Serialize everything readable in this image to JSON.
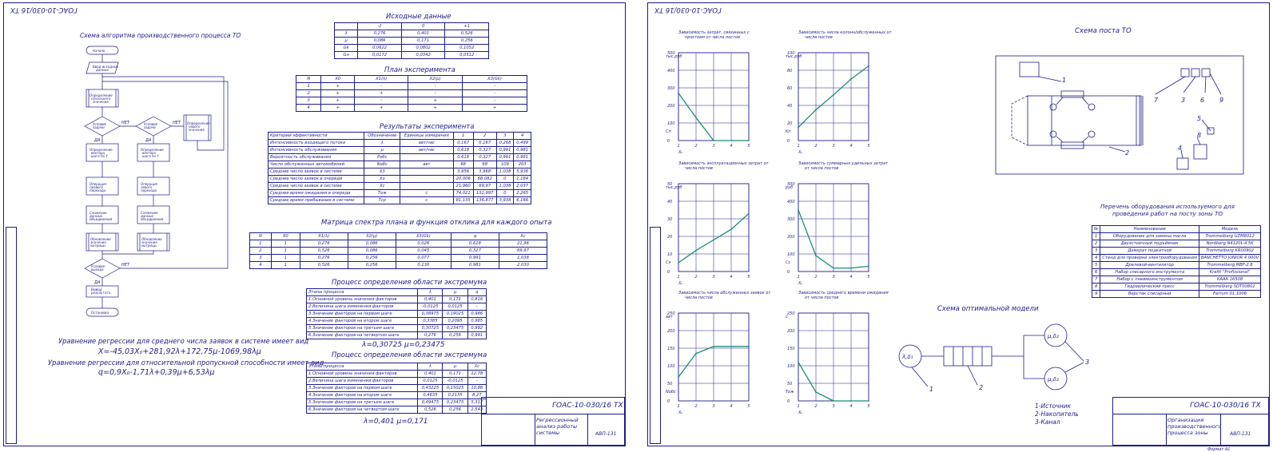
{
  "sheet1": {
    "code_rotated": "ГОАС-10-030/16 ТХ",
    "flowchart_title": "Схема алгоритма производственного процесса ТО",
    "flow": {
      "start": "Начало",
      "end": "Остановка",
      "yes": "ДА",
      "no": "НЕТ"
    },
    "initial_title": "Исходные данные",
    "initial_header": [
      "",
      "-1",
      "0",
      "+1"
    ],
    "initial_rows": [
      [
        "λ",
        "0,276",
        "0,401",
        "0,526"
      ],
      [
        "μ",
        "0,086",
        "0,171",
        "0,256"
      ],
      [
        "Gk",
        "0,0622",
        "0,0802",
        "0,1052"
      ],
      [
        "Gн",
        "0,0172",
        "0,0342",
        "0,0512"
      ]
    ],
    "plan_title": "План эксперимента",
    "plan_header": [
      "N",
      "X0",
      "X1(λ)",
      "X2(μ)",
      "X3(Gk)"
    ],
    "plan_rows": [
      [
        "1",
        "+",
        "-",
        "-",
        "-"
      ],
      [
        "2",
        "+",
        "+",
        "-",
        "-"
      ],
      [
        "3",
        "+",
        "-",
        "+",
        "-"
      ],
      [
        "4",
        "+",
        "+",
        "+",
        "+"
      ]
    ],
    "results_title": "Результаты эксперимента",
    "results_header": [
      "Критерии эффективности",
      "Обозначение",
      "Единицы измерения",
      "1",
      "2",
      "3",
      "4"
    ],
    "results_rows": [
      [
        "Интенсивность входящего потока",
        "λ",
        "авт/час",
        "0,167",
        "0,167",
        "0,268",
        "0,499"
      ],
      [
        "Интенсивность обслуживания",
        "μ",
        "авт/час",
        "0,618",
        "0,327",
        "0,991",
        "0,981"
      ],
      [
        "Вероятность обслуживания",
        "Pобс",
        "",
        "0,618",
        "0,327",
        "0,991",
        "0,981"
      ],
      [
        "Число обслуженных автомобилей",
        "Nобс",
        "авт",
        "68",
        "68",
        "109",
        "203"
      ],
      [
        "Среднее число заявок в системе",
        "X3",
        "",
        "3,956",
        "3,968",
        "1,038",
        "5,936"
      ],
      [
        "Среднее число заявок в очереди",
        "Xо",
        "",
        "20,006",
        "68,082",
        "0",
        "1,184"
      ],
      [
        "Среднее число заявок в системе",
        "Xс",
        "",
        "21,960",
        "69,97",
        "1,038",
        "2,037"
      ],
      [
        "Среднее время ожидания в очереди",
        "Tож",
        "с",
        "74,021",
        "132,997",
        "0",
        "2,265"
      ],
      [
        "Среднее время пребывания в системе",
        "Tср",
        "с",
        "81,135",
        "136,877",
        "3,938",
        "6,166"
      ]
    ],
    "matrix_title": "Матрица спектра плана и функция отклика для каждого опыта",
    "matrix_header": [
      "N",
      "X0",
      "X1(λ)",
      "X2(μ)",
      "X3(Gk)",
      "q",
      "Xc"
    ],
    "matrix_rows": [
      [
        "1",
        "1",
        "0,276",
        "0,086",
        "0,026",
        "0,618",
        "21,96"
      ],
      [
        "2",
        "1",
        "0,526",
        "0,086",
        "0,045",
        "0,327",
        "69,97"
      ],
      [
        "3",
        "1",
        "0,276",
        "0,256",
        "0,077",
        "0,991",
        "1,038"
      ],
      [
        "4",
        "1",
        "0,526",
        "0,256",
        "0,130",
        "0,981",
        "2,030"
      ]
    ],
    "process1_title": "Процесс определения области экстремума",
    "process1_header": [
      "Этапы процесса",
      "λ",
      "μ",
      "q"
    ],
    "process1_rows": [
      [
        "1.Основной уровень значения факторов",
        "0,401",
        "0,171",
        "0,816"
      ],
      [
        "2.Величина шага изменения факторов",
        "-0,0125",
        "0,0125",
        "-"
      ],
      [
        "3.Значение факторов на первом шаге",
        "0,36975",
        "0,19025",
        "0,986"
      ],
      [
        "4.Значение факторов на втором шаге",
        "0,3385",
        "0,2095",
        "0,985"
      ],
      [
        "5.Значение факторов на третьем шаге",
        "0,30725",
        "0,23475",
        "0,992"
      ],
      [
        "6.Значение факторов на четвертом шаге",
        "0,276",
        "0,256",
        "0,991"
      ]
    ],
    "result1": "λ=0,30725   μ=0,23475",
    "process2_title": "Процесс определения области экстремума",
    "process2_header": [
      "Этапы процесса",
      "λ",
      "μ",
      "Xc"
    ],
    "process2_rows": [
      [
        "1.Основной уровень значения факторов",
        "0,401",
        "0,171",
        "12,78"
      ],
      [
        "2.Величина шага изменения факторов",
        "0,0125",
        "-0,0125",
        "-"
      ],
      [
        "3.Значение факторов на первом шаге",
        "0,43225",
        "0,15025",
        "10,86"
      ],
      [
        "4.Значение факторов на втором шаге",
        "0,4635",
        "0,2135",
        "8,27"
      ],
      [
        "5.Значение факторов на третьем шаге",
        "0,49475",
        "0,23475",
        "5,317"
      ],
      [
        "6.Значение факторов на четвертом шаге",
        "0,526",
        "0,256",
        "2,543"
      ]
    ],
    "result2": "λ=0,401   μ=0,171",
    "regression_1_title": "Уравнение регрессии для среднего числа заявок в системе имеет вид",
    "regression_1": "X=-45,03X₀+281,92λ+172,75μ-1069,98λμ",
    "regression_2_title": "Уравнение регрессии для относительной пропускной способности имеет вид",
    "regression_2": "q=0,9X₀-1,71λ+0,39μ+6,53λμ",
    "stamp_code": "ГОАС-10-030/16 ТХ",
    "stamp_title": "Регрессионный анализ работы системы",
    "stamp_group": "АВП-131"
  },
  "sheet2": {
    "code_rotated": "ГОАС-10-030/16 ТХ",
    "charts_x_label": "Xₖ",
    "post_title": "Схема поста ТО",
    "post_callouts": [
      "1",
      "2",
      "3",
      "4",
      "5",
      "6",
      "7",
      "8",
      "9"
    ],
    "equipment_title": "Перечень оборудования используемого для проведения работ на посту зоны ТО",
    "equipment_header": [
      "№",
      "Наименование",
      "Модель"
    ],
    "equipment_rows": [
      [
        "1",
        "Оборудование для замены масла",
        "Trommelberg UZM8012"
      ],
      [
        "2",
        "Двухстоечный подъёмник",
        "Nordberg N4120L-4,5K"
      ],
      [
        "3",
        "Домкрат подкатной",
        "Trommelberg KR00902"
      ],
      [
        "4",
        "Стенд для проверки электрооборудования",
        "BANCHETTO JUNIOR 4.000V"
      ],
      [
        "5",
        "Дрелевой-вентилятор",
        "Trommelberg MBF-2.8"
      ],
      [
        "6",
        "Набор слесарного инструмента",
        "Kraftt \"Profissional\""
      ],
      [
        "7",
        "Набор с пневмоинструментом",
        "KAAA 16508"
      ],
      [
        "8",
        "Гидравлический пресс",
        "Trommelberg SDT00802"
      ],
      [
        "9",
        "Верстак слесарный",
        "Ferrum 01.1006"
      ]
    ],
    "model_title": "Схема оптимальной модели",
    "model_source": "λ,δ₁",
    "model_channel": "μ,δ₂",
    "model_legend": [
      "1-Источник",
      "2-Накопитель",
      "3-Канал"
    ],
    "stamp_code": "ГОАС-10-030/16 ТХ",
    "stamp_title": "Организация производственного процесса зоны",
    "stamp_group": "АВП-131",
    "stamp_format": "Формат А1"
  },
  "chart_data": [
    {
      "type": "line",
      "title": "Зависимость затрат, связанных с простоем от числа постов",
      "x": [
        1,
        2,
        3,
        4,
        5
      ],
      "values": [
        270,
        130,
        0,
        0,
        0
      ],
      "ylabel": "Cп",
      "yunit": "тыс.руб",
      "xlabel": "Xₖ",
      "ylim": [
        0,
        500
      ],
      "yticks": [
        0,
        100,
        200,
        300,
        400,
        500
      ]
    },
    {
      "type": "line",
      "title": "Зависимость числа колонн/обслуженных от числа постов",
      "x": [
        1,
        2,
        3,
        4,
        5
      ],
      "values": [
        15,
        35,
        52,
        70,
        85
      ],
      "ylabel": "Kп",
      "yunit": "тыс.руб",
      "xlabel": "Xₖ",
      "ylim": [
        0,
        100
      ],
      "yticks": [
        0,
        20,
        40,
        60,
        80,
        100
      ]
    },
    {
      "type": "line",
      "title": "Зависимость эксплуатационных затрат от числа постов",
      "x": [
        1,
        2,
        3,
        4,
        5
      ],
      "values": [
        5,
        12,
        18,
        24,
        33
      ],
      "ylabel": "Cэ",
      "yunit": "тыс.руб",
      "xlabel": "Xₖ",
      "ylim": [
        0,
        50
      ],
      "yticks": [
        0,
        10,
        20,
        30,
        40,
        50
      ]
    },
    {
      "type": "line",
      "title": "Зависимость суммарных удельных затрат от числа постов",
      "x": [
        1,
        2,
        3,
        4,
        5
      ],
      "values": [
        350,
        90,
        20,
        20,
        30
      ],
      "ylabel": "Cс",
      "yunit": "руб",
      "xlabel": "Xₖ",
      "ylim": [
        0,
        500
      ],
      "yticks": [
        0,
        100,
        200,
        300,
        400,
        500
      ]
    },
    {
      "type": "line",
      "title": "Зависимость числа обслуженных заявок от числа постов",
      "x": [
        1,
        2,
        3,
        4,
        5
      ],
      "values": [
        68,
        135,
        155,
        155,
        155
      ],
      "ylabel": "Nобс",
      "yunit": "авт",
      "xlabel": "Xₖ",
      "ylim": [
        0,
        250
      ],
      "yticks": [
        0,
        50,
        100,
        150,
        200,
        250
      ]
    },
    {
      "type": "line",
      "title": "Зависимость среднего времени ожидания от числа постов",
      "x": [
        1,
        2,
        3,
        4,
        5
      ],
      "values": [
        110,
        25,
        0,
        0,
        0
      ],
      "ylabel": "Tож",
      "yunit": "с",
      "xlabel": "Xₖ",
      "ylim": [
        0,
        250
      ],
      "yticks": [
        0,
        50,
        100,
        150,
        200,
        250
      ]
    }
  ]
}
